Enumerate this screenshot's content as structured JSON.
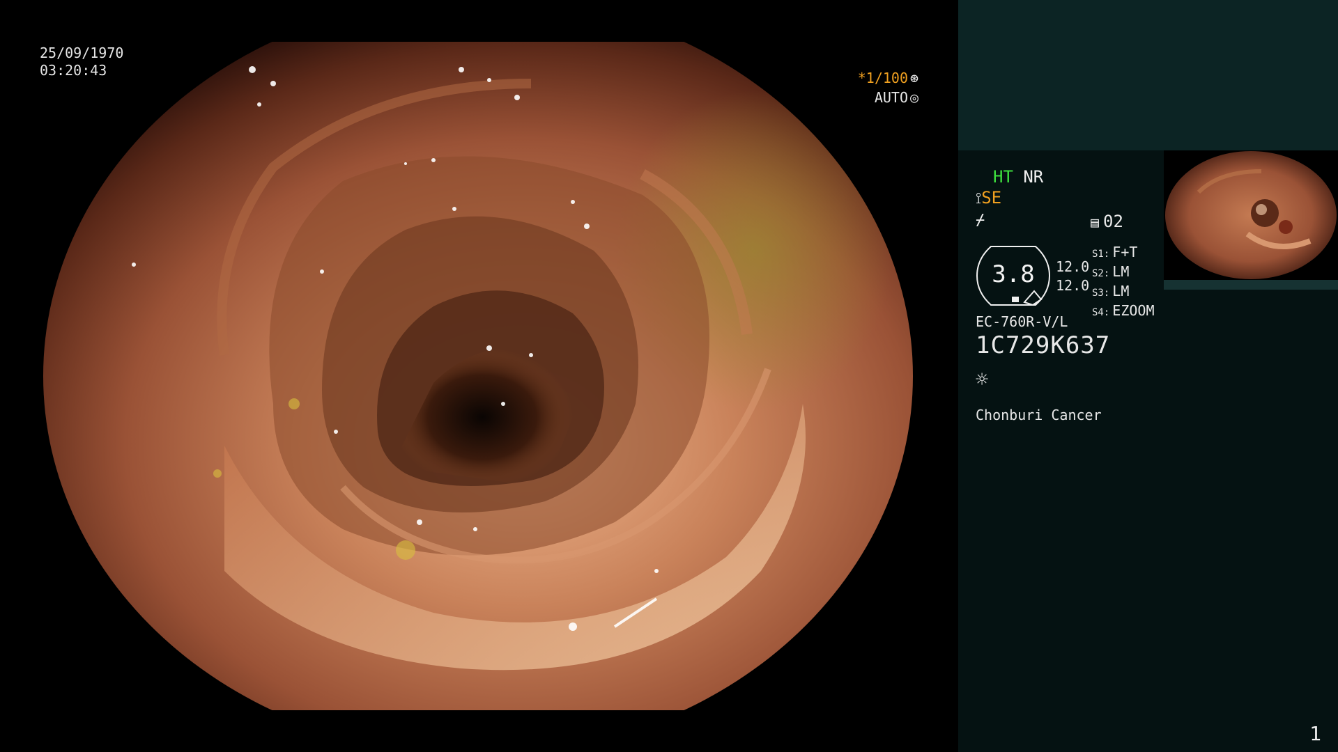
{
  "overlay": {
    "date": "25/09/1970",
    "time": "03:20:43",
    "shutter": "*1/100",
    "iris_mode": "AUTO"
  },
  "panel": {
    "enhancement_label": "HT",
    "noise_reduction_label": "NR",
    "structure_enhancement_label": "SE",
    "memory_index": "02",
    "zoom_ratio": "3.8",
    "dual_values": [
      "12.0",
      "12.0"
    ],
    "switches": [
      {
        "key": "S1:",
        "value": "F+T"
      },
      {
        "key": "S2:",
        "value": "LM"
      },
      {
        "key": "S3:",
        "value": "LM"
      },
      {
        "key": "S4:",
        "value": "EZOOM"
      }
    ],
    "scope_model": "EC-760R-V/L",
    "serial_number": "1C729K637",
    "hospital": "Chonburi Cancer",
    "page_number": "1"
  },
  "colors": {
    "panel_bg": "#051212",
    "panel_header_bg": "#0c2424",
    "accent_orange": "#f0a020",
    "accent_green": "#3ee03e"
  },
  "icons": {
    "shutter": "aperture-icon",
    "iris": "iris-icon",
    "memory": "memory-card-icon",
    "light": "light-source-icon"
  }
}
